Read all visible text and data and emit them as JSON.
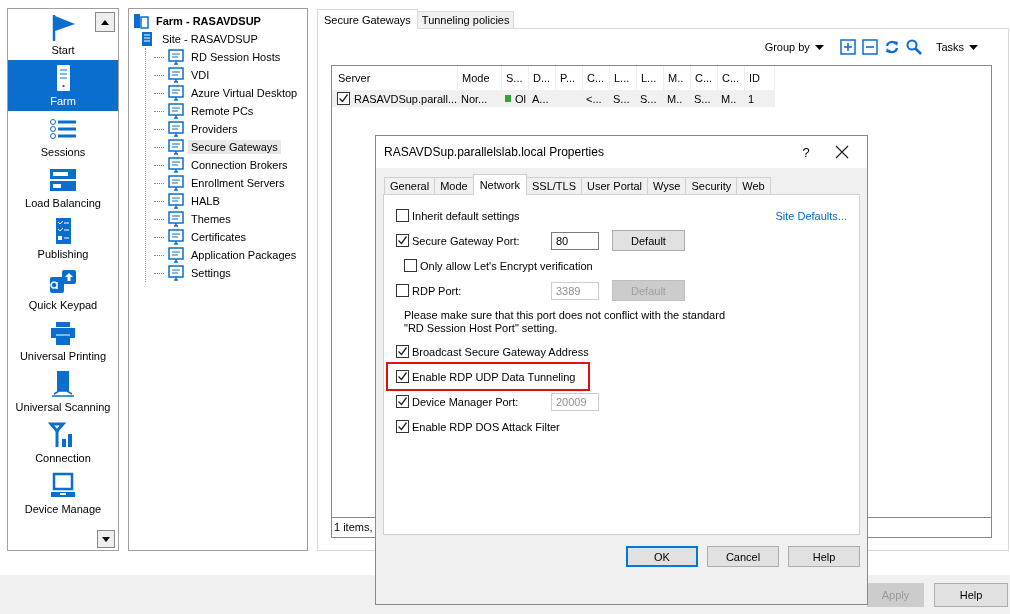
{
  "nav": {
    "items": [
      {
        "label": "Start",
        "selected": false
      },
      {
        "label": "Farm",
        "selected": true
      },
      {
        "label": "Sessions",
        "selected": false
      },
      {
        "label": "Load Balancing",
        "selected": false
      },
      {
        "label": "Publishing",
        "selected": false
      },
      {
        "label": "Quick Keypad",
        "selected": false
      },
      {
        "label": "Universal Printing",
        "selected": false
      },
      {
        "label": "Universal Scanning",
        "selected": false
      },
      {
        "label": "Connection",
        "selected": false
      },
      {
        "label": "Device Manage",
        "selected": false
      }
    ]
  },
  "tree": {
    "label": "Farm - RASAVDSUP",
    "selected": false,
    "children": [
      {
        "label": "Site - RASAVDSUP",
        "selected": false,
        "children": [
          {
            "label": "RD Session Hosts",
            "selected": false
          },
          {
            "label": "VDI",
            "selected": false
          },
          {
            "label": "Azure Virtual Desktop",
            "selected": false
          },
          {
            "label": "Remote PCs",
            "selected": false
          },
          {
            "label": "Providers",
            "selected": false
          },
          {
            "label": "Secure Gateways",
            "selected": true
          },
          {
            "label": "Connection Brokers",
            "selected": false
          },
          {
            "label": "Enrollment Servers",
            "selected": false
          },
          {
            "label": "HALB",
            "selected": false
          },
          {
            "label": "Themes",
            "selected": false
          },
          {
            "label": "Certificates",
            "selected": false
          },
          {
            "label": "Application Packages",
            "selected": false
          },
          {
            "label": "Settings",
            "selected": false
          }
        ]
      }
    ]
  },
  "main": {
    "tabs": [
      {
        "label": "Secure Gateways",
        "selected": true
      },
      {
        "label": "Tunneling policies",
        "selected": false
      }
    ],
    "toolbar": {
      "group_by": "Group by",
      "tasks": "Tasks"
    },
    "table": {
      "columns": [
        "Server",
        "Mode",
        "S...",
        "D...",
        "P...",
        "C...",
        "L...",
        "L...",
        "M..",
        "C...",
        "C...",
        "ID"
      ],
      "rows": [
        {
          "checked": true,
          "color": "#3aa13a",
          "cells": [
            "RASAVDSup.parall...",
            "Nor...",
            "Ol",
            "A...",
            null,
            "<...",
            "S...",
            "S...",
            "M..",
            "S...",
            "M..",
            "1"
          ]
        }
      ],
      "footer": "1 items,"
    }
  },
  "dialog": {
    "title": "RASAVDSup.parallelslab.local Properties",
    "help": "?",
    "tabs": [
      {
        "label": "General",
        "selected": false
      },
      {
        "label": "Mode",
        "selected": false
      },
      {
        "label": "Network",
        "selected": true
      },
      {
        "label": "SSL/TLS",
        "selected": false
      },
      {
        "label": "User Portal",
        "selected": false
      },
      {
        "label": "Wyse",
        "selected": false
      },
      {
        "label": "Security",
        "selected": false
      },
      {
        "label": "Web",
        "selected": false
      }
    ],
    "rows": [
      {
        "kind": "checkbox",
        "label": "Inherit default settings",
        "checked": false,
        "link": "Site Defaults..."
      },
      {
        "kind": "checkbox",
        "label": "Secure Gateway Port:",
        "checked": true,
        "field": {
          "value": "80",
          "disabled": false
        },
        "button": {
          "label": "Default",
          "disabled": false
        }
      },
      {
        "kind": "subcheckbox",
        "label": "Only allow Let's Encrypt verification",
        "checked": false
      },
      {
        "kind": "checkbox",
        "label": "RDP Port:",
        "checked": false,
        "field": {
          "value": "3389",
          "disabled": true
        },
        "button": {
          "label": "Default",
          "disabled": true
        }
      },
      {
        "kind": "note",
        "text": "Please make sure that this port does not conflict with the standard\n\"RD Session Host Port\" setting."
      },
      {
        "kind": "checkbox",
        "label": "Broadcast Secure Gateway Address",
        "checked": true
      },
      {
        "kind": "checkbox",
        "label": "Enable RDP UDP Data Tunneling",
        "checked": true,
        "highlighted": true
      },
      {
        "kind": "checkbox",
        "label": "Device Manager Port:",
        "checked": true,
        "field": {
          "value": "20009",
          "disabled": true
        }
      },
      {
        "kind": "checkbox",
        "label": "Enable RDP DOS Attack Filter",
        "checked": true
      }
    ],
    "buttons": [
      {
        "label": "OK",
        "default": true
      },
      {
        "label": "Cancel",
        "default": false
      },
      {
        "label": "Help",
        "default": false
      }
    ]
  },
  "bottom_buttons": [
    {
      "label": "Apply",
      "disabled": true
    },
    {
      "label": "Help",
      "disabled": false
    }
  ]
}
